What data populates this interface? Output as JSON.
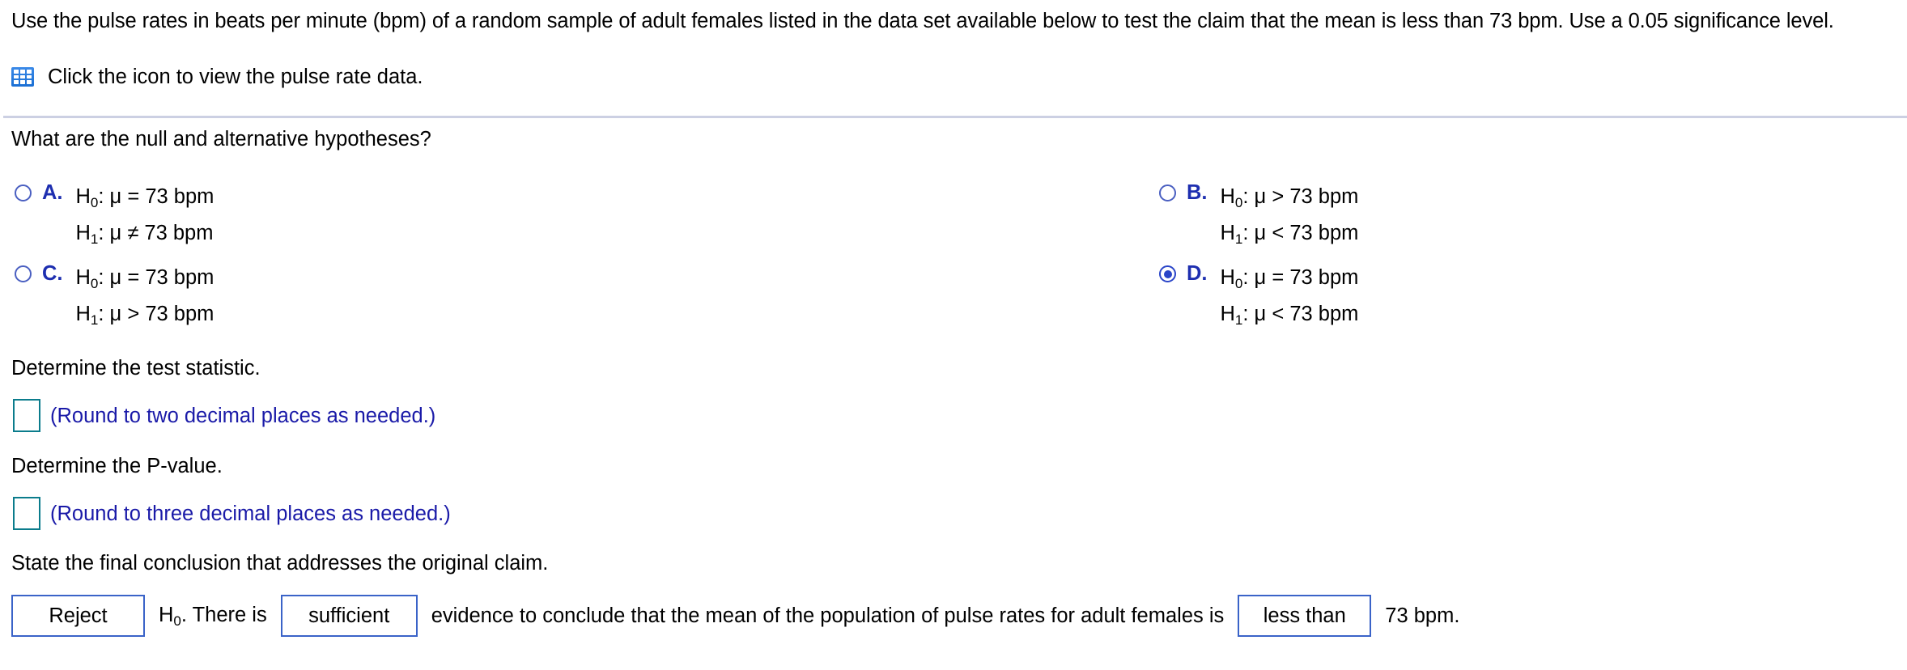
{
  "problem": {
    "statement": "Use the pulse rates in beats per minute (bpm) of a random sample of adult females listed in the data set available below to test the claim that the mean is less than 73 bpm. Use a 0.05 significance level.",
    "data_link_text": "Click the icon to view the pulse rate data.",
    "data_icon": "table-grid-icon"
  },
  "hypotheses_question": {
    "prompt": "What are the null and alternative hypotheses?",
    "options": [
      {
        "letter": "A.",
        "selected": false,
        "null_label": "H",
        "null_sub": "0",
        "null_rest": ": μ = 73 bpm",
        "alt_label": "H",
        "alt_sub": "1",
        "alt_rest": ": μ ≠ 73 bpm"
      },
      {
        "letter": "B.",
        "selected": false,
        "null_label": "H",
        "null_sub": "0",
        "null_rest": ": μ > 73 bpm",
        "alt_label": "H",
        "alt_sub": "1",
        "alt_rest": ": μ < 73 bpm"
      },
      {
        "letter": "C.",
        "selected": false,
        "null_label": "H",
        "null_sub": "0",
        "null_rest": ": μ = 73 bpm",
        "alt_label": "H",
        "alt_sub": "1",
        "alt_rest": ": μ > 73 bpm"
      },
      {
        "letter": "D.",
        "selected": true,
        "null_label": "H",
        "null_sub": "0",
        "null_rest": ": μ = 73 bpm",
        "alt_label": "H",
        "alt_sub": "1",
        "alt_rest": ": μ < 73 bpm"
      }
    ]
  },
  "test_statistic": {
    "prompt": "Determine the test statistic.",
    "value": "",
    "hint": "(Round to two decimal places as needed.)"
  },
  "p_value": {
    "prompt": "Determine the P-value.",
    "value": "",
    "hint": "(Round to three decimal places as needed.)"
  },
  "conclusion": {
    "prompt": "State the final conclusion that addresses the original claim.",
    "decision": "Reject",
    "h_label": "H",
    "h_sub": "0",
    "text_after_h": ". There is",
    "sufficiency": "sufficient",
    "middle_text": "evidence to conclude that the mean of the population of pulse rates for adult females is",
    "comparison": "less than",
    "tail_text": "73 bpm."
  },
  "colors": {
    "choice_letter": "#1e2fb0",
    "radio": "#4a5fc1",
    "radio_selected": "#2a45c8",
    "answer_box_border": "#0b7c8c",
    "hint_text": "#1a1aa8",
    "dropdown_border": "#3a63c8",
    "divider": "#ccd0e3",
    "icon_blue": "#2d7dd2"
  }
}
